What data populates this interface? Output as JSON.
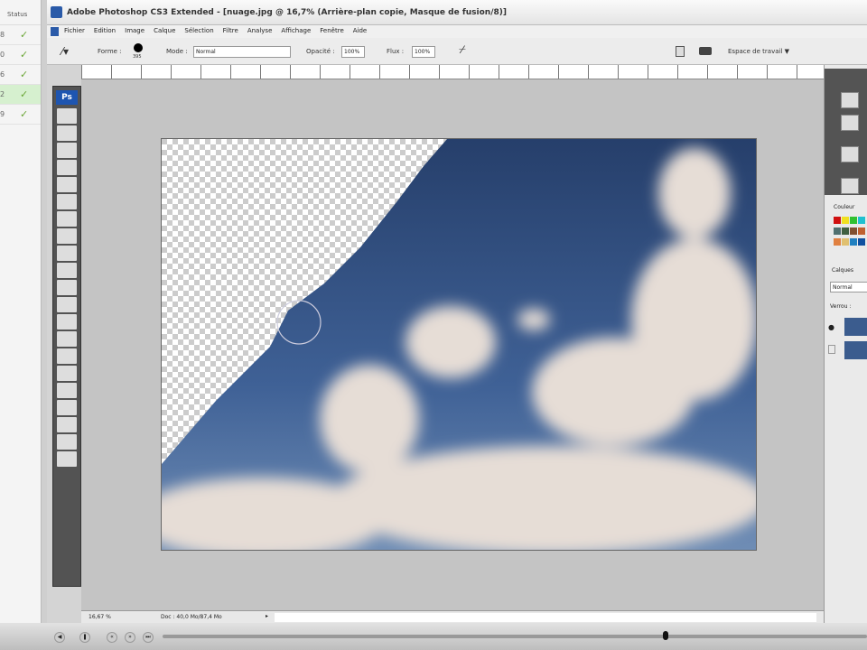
{
  "left_list": {
    "header": "Status",
    "rows": [
      {
        "id": "8",
        "status": "✓"
      },
      {
        "id": "0",
        "status": "✓"
      },
      {
        "id": "6",
        "status": "✓"
      },
      {
        "id": "2",
        "status": "✓",
        "selected": true
      },
      {
        "id": "9",
        "status": "✓"
      }
    ]
  },
  "window": {
    "title": "Adobe Photoshop CS3 Extended - [nuage.jpg @ 16,7% (Arrière-plan copie, Masque de fusion/8)]"
  },
  "menu": [
    "Fichier",
    "Edition",
    "Image",
    "Calque",
    "Sélection",
    "Filtre",
    "Analyse",
    "Affichage",
    "Fenêtre",
    "Aide"
  ],
  "options": {
    "forme_label": "Forme :",
    "brush_size": "395",
    "mode_label": "Mode :",
    "mode_value": "Normal",
    "opacity_label": "Opacité :",
    "opacity_value": "100%",
    "flux_label": "Flux :",
    "flux_value": "100%",
    "workspace_label": "Espace de travail ▼"
  },
  "toolbox": {
    "logo": "Ps"
  },
  "right_panel": {
    "color_tab": "Couleur",
    "layers_tab": "Calques",
    "blend_mode": "Normal",
    "lock_label": "Verrou :"
  },
  "status": {
    "zoom": "16,67 %",
    "doc": "Doc : 40,0 Mo/87,4 Mo"
  },
  "player": {
    "progress": 0.71
  },
  "colors": {
    "sky": "#3b5c8e",
    "toolbox": "#535353",
    "workspace": "#c4c4c4"
  }
}
